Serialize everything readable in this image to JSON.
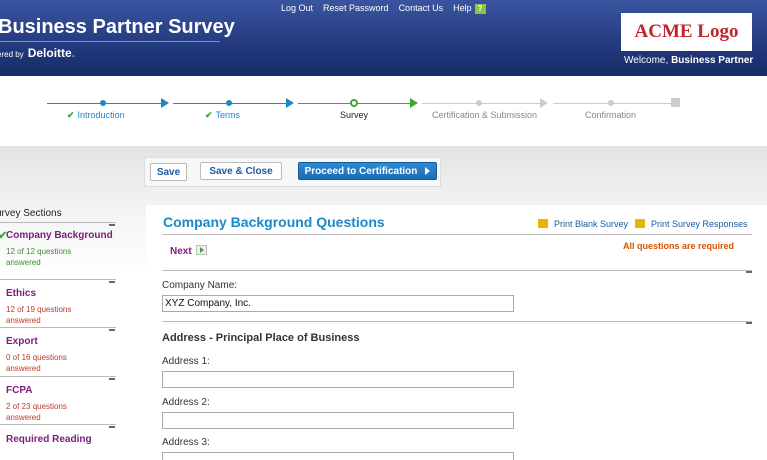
{
  "header": {
    "links": [
      "Log Out",
      "Reset Password",
      "Contact Us",
      "Help"
    ],
    "help_badge": "?",
    "app_title": "Business Partner Survey",
    "powered_by": "ered by",
    "brand": "Deloitte",
    "brand_dot": ".",
    "logo_text": "ACME Logo",
    "welcome_prefix": "Welcome, ",
    "welcome_user": "Business Partner"
  },
  "progress": {
    "steps": [
      {
        "label": "Introduction",
        "status": "complete"
      },
      {
        "label": "Terms",
        "status": "complete"
      },
      {
        "label": "Survey",
        "status": "current"
      },
      {
        "label": "Certification & Submission",
        "status": "pending"
      },
      {
        "label": "Confirmation",
        "status": "pending"
      }
    ],
    "colors": {
      "complete": "#1b89c8",
      "current": "#3aa935",
      "pending": "#bbbbbb"
    }
  },
  "toolbar": {
    "save_label": "Save",
    "save_close_label": "Save & Close",
    "proceed_label": "Proceed to Certification"
  },
  "sidebar": {
    "title": "urvey Sections",
    "items": [
      {
        "label": "Company Background",
        "sub": "12 of 12 questions answered",
        "done": true
      },
      {
        "label": "Ethics",
        "sub": "12 of 19 questions answered",
        "done": false
      },
      {
        "label": "Export",
        "sub": "0 of 16 questions answered",
        "done": false
      },
      {
        "label": "FCPA",
        "sub": "2 of 23 questions answered",
        "done": false
      },
      {
        "label": "Required Reading",
        "sub": "",
        "done": false
      }
    ]
  },
  "main": {
    "title": "Company Background Questions",
    "print_blank": "Print Blank Survey",
    "print_responses": "Print Survey Responses",
    "required_note": "All questions are required",
    "next_label": "Next",
    "company_label": "Company Name:",
    "company_value": "XYZ Company, Inc.",
    "address_heading": "Address - Principal Place of Business",
    "address1_label": "Address 1:",
    "address2_label": "Address 2:",
    "address3_label": "Address 3:",
    "address1_value": "",
    "address2_value": "",
    "address3_value": ""
  }
}
